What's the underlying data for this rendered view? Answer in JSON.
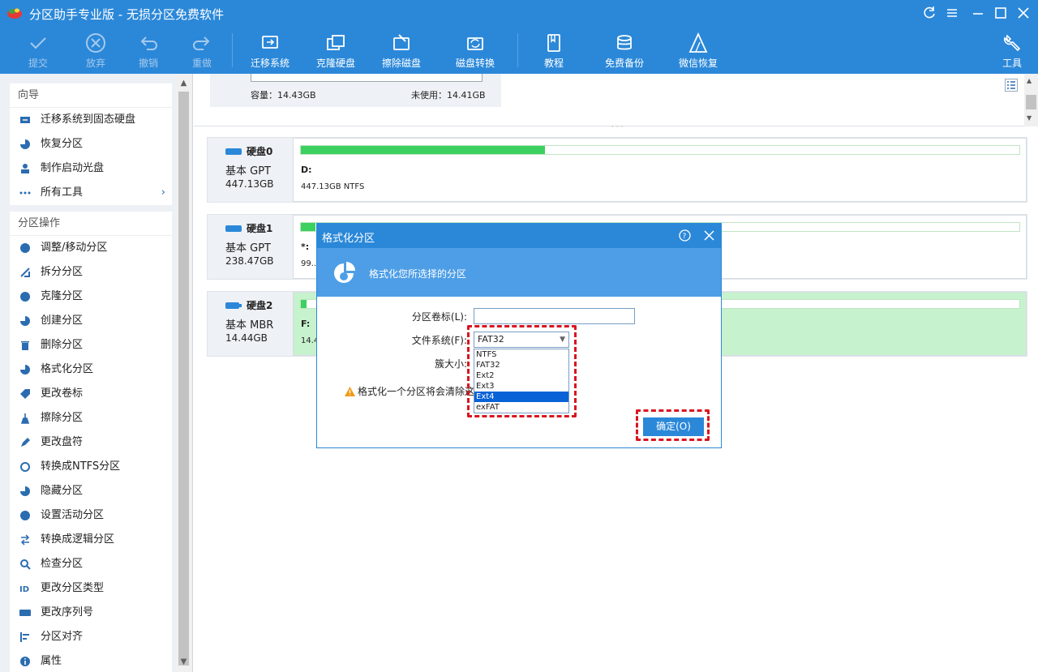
{
  "window": {
    "title": "分区助手专业版 - 无损分区免费软件"
  },
  "toolbar": {
    "commit": "提交",
    "discard": "放弃",
    "undo": "撤销",
    "redo": "重做",
    "migrate": "迁移系统",
    "clone_disk": "克隆硬盘",
    "wipe_disk": "擦除磁盘",
    "convert": "磁盘转换",
    "tutorial": "教程",
    "backup": "免费备份",
    "wechat_recovery": "微信恢复",
    "tools": "工具"
  },
  "sidebar": {
    "wizard": {
      "title": "向导",
      "items": [
        "迁移系统到固态硬盘",
        "恢复分区",
        "制作启动光盘",
        "所有工具"
      ]
    },
    "ops": {
      "title": "分区操作",
      "items": [
        "调整/移动分区",
        "拆分分区",
        "克隆分区",
        "创建分区",
        "删除分区",
        "格式化分区",
        "更改卷标",
        "擦除分区",
        "更改盘符",
        "转换成NTFS分区",
        "隐藏分区",
        "设置活动分区",
        "转换成逻辑分区",
        "检查分区",
        "更改分区类型",
        "更改序列号",
        "分区对齐",
        "属性"
      ]
    }
  },
  "top_pane": {
    "capacity": "容量：14.43GB",
    "unused": "未使用：14.41GB"
  },
  "disks": [
    {
      "name": "硬盘0",
      "type": "基本 GPT",
      "size": "447.13GB",
      "part_letter": "D:",
      "part_info": "447.13GB NTFS",
      "used_fraction": 0.34
    },
    {
      "name": "硬盘1",
      "type": "基本 GPT",
      "size": "238.47GB",
      "part_letter": "*:",
      "part_info": "99...",
      "used_fraction": 0.02
    },
    {
      "name": "硬盘2",
      "type": "基本 MBR",
      "size": "14.44GB",
      "part_letter": "F:",
      "part_info": "14.4",
      "used_fraction": 0.005
    }
  ],
  "dialog": {
    "title": "格式化分区",
    "banner": "格式化您所选择的分区",
    "label_volume": "分区卷标(L):",
    "label_fs": "文件系统(F):",
    "label_cluster": "簇大小:",
    "warning": "格式化一个分区将会清除这",
    "fs_selected": "FAT32",
    "fs_options": [
      "NTFS",
      "FAT32",
      "Ext2",
      "Ext3",
      "Ext4",
      "exFAT"
    ],
    "fs_highlighted": "Ext4",
    "ok": "确定(O)"
  },
  "colors": {
    "accent": "#2b88d9",
    "highlight": "#d9141e",
    "partition_green": "#3cd060"
  }
}
